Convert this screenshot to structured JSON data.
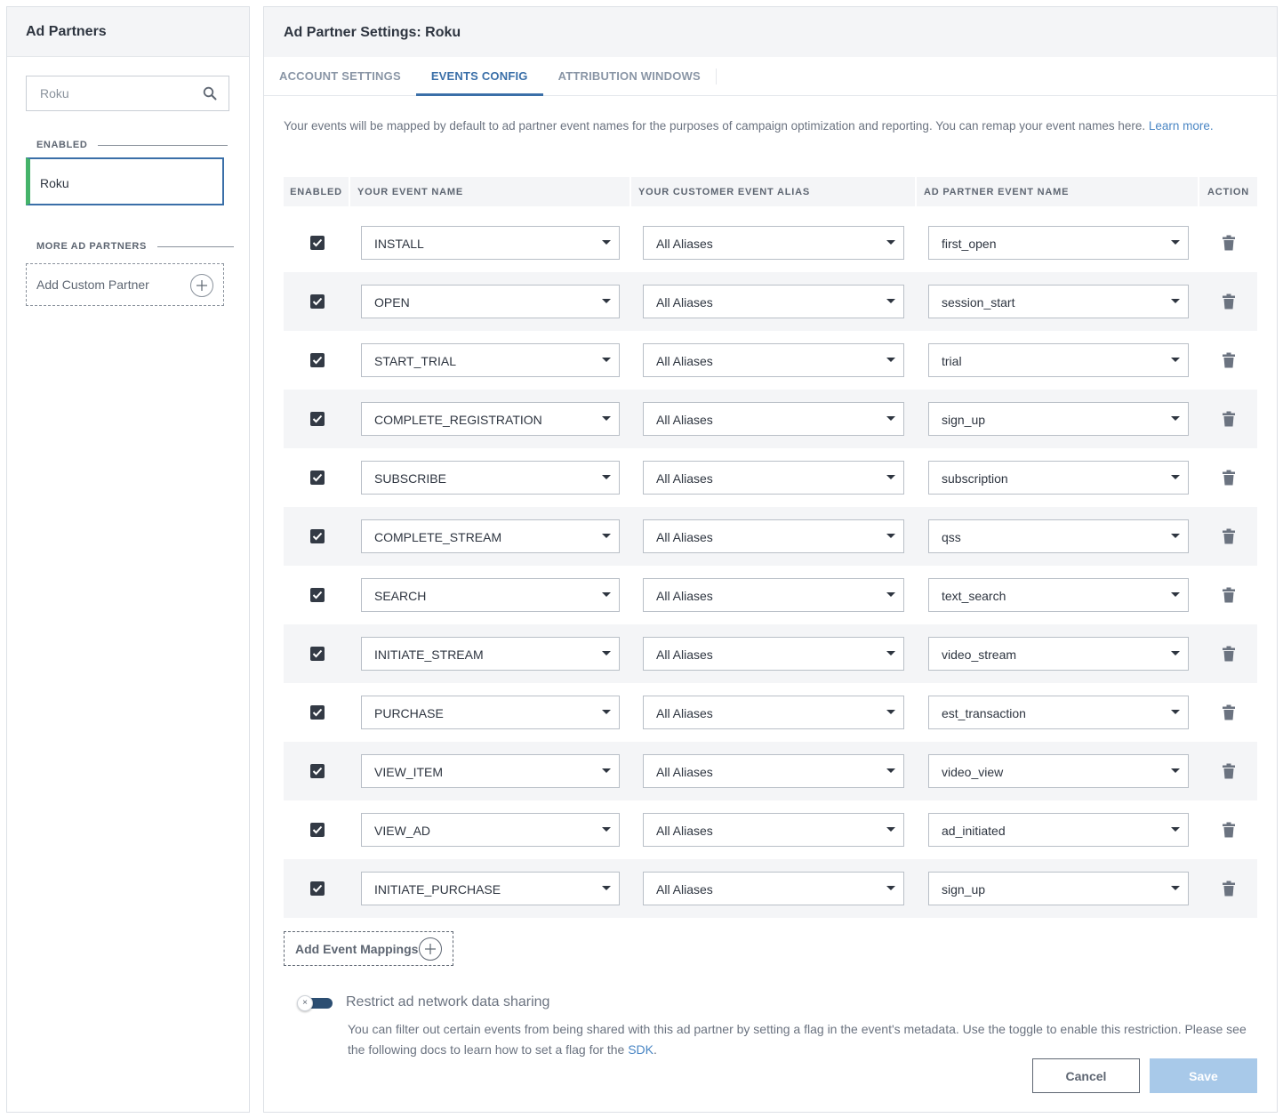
{
  "left": {
    "title": "Ad Partners",
    "search_placeholder": "Roku",
    "enabled_label": "ENABLED",
    "enabled_partner": "Roku",
    "more_label": "MORE AD PARTNERS",
    "add_custom_label": "Add Custom Partner"
  },
  "right": {
    "title": "Ad Partner Settings: Roku",
    "tabs": [
      {
        "label": "ACCOUNT SETTINGS",
        "active": false
      },
      {
        "label": "EVENTS CONFIG",
        "active": true
      },
      {
        "label": "ATTRIBUTION WINDOWS",
        "active": false
      }
    ],
    "intro_text": "Your events will be mapped by default to ad partner event names for the purposes of campaign optimization and reporting. You can remap your event names here.",
    "intro_link": "Learn more."
  },
  "table": {
    "headers": {
      "enabled": "ENABLED",
      "event": "YOUR EVENT NAME",
      "alias": "YOUR CUSTOMER EVENT ALIAS",
      "partner": "AD PARTNER EVENT NAME",
      "action": "ACTION"
    },
    "rows": [
      {
        "enabled": true,
        "event": "INSTALL",
        "alias": "All Aliases",
        "partner": "first_open"
      },
      {
        "enabled": true,
        "event": "OPEN",
        "alias": "All Aliases",
        "partner": "session_start"
      },
      {
        "enabled": true,
        "event": "START_TRIAL",
        "alias": "All Aliases",
        "partner": "trial"
      },
      {
        "enabled": true,
        "event": "COMPLETE_REGISTRATION",
        "alias": "All Aliases",
        "partner": "sign_up"
      },
      {
        "enabled": true,
        "event": "SUBSCRIBE",
        "alias": "All Aliases",
        "partner": "subscription"
      },
      {
        "enabled": true,
        "event": "COMPLETE_STREAM",
        "alias": "All Aliases",
        "partner": "qss"
      },
      {
        "enabled": true,
        "event": "SEARCH",
        "alias": "All Aliases",
        "partner": "text_search"
      },
      {
        "enabled": true,
        "event": "INITIATE_STREAM",
        "alias": "All Aliases",
        "partner": "video_stream"
      },
      {
        "enabled": true,
        "event": "PURCHASE",
        "alias": "All Aliases",
        "partner": "est_transaction"
      },
      {
        "enabled": true,
        "event": "VIEW_ITEM",
        "alias": "All Aliases",
        "partner": "video_view"
      },
      {
        "enabled": true,
        "event": "VIEW_AD",
        "alias": "All Aliases",
        "partner": "ad_initiated"
      },
      {
        "enabled": true,
        "event": "INITIATE_PURCHASE",
        "alias": "All Aliases",
        "partner": "sign_up"
      }
    ]
  },
  "footer": {
    "add_mappings_label": "Add Event Mappings",
    "toggle_icon": "×",
    "restrict_title": "Restrict ad network data sharing",
    "restrict_desc": "You can filter out certain events from being shared with this ad partner by setting a flag in the event's metadata. Use the toggle to enable this restriction. Please see the following docs to learn how to set a flag for the",
    "restrict_link": "SDK",
    "restrict_end": ".",
    "cancel_label": "Cancel",
    "save_label": "Save"
  },
  "colors": {
    "accent": "#3a6fa8",
    "enabled_marker": "#45b36a",
    "save_disabled": "#a8c9e9",
    "toggle_track": "#2c4e72"
  }
}
